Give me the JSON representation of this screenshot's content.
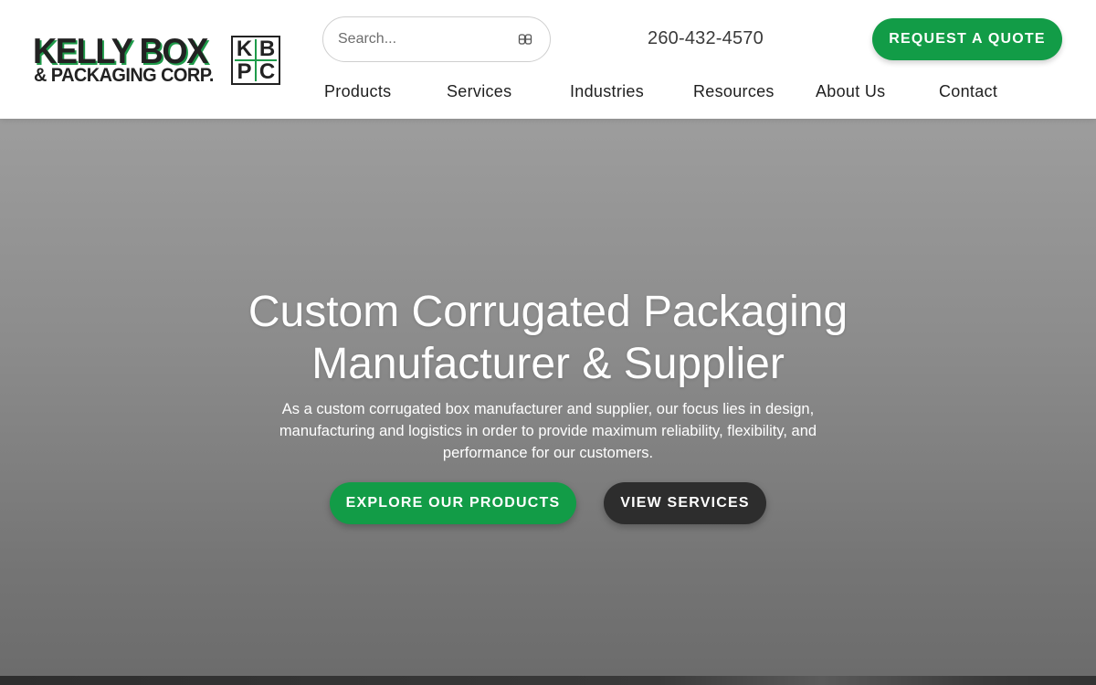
{
  "brand": {
    "name_line1": "KELLY BOX",
    "name_line2": "& PACKAGING CORP.",
    "monogram": [
      "K",
      "B",
      "P",
      "C"
    ],
    "accent_color": "#129c47"
  },
  "search": {
    "placeholder": "Search...",
    "icon": "search-icon"
  },
  "header": {
    "phone": "260-432-4570",
    "quote_label": "REQUEST A QUOTE"
  },
  "nav": {
    "items": [
      {
        "label": "Products"
      },
      {
        "label": "Services"
      },
      {
        "label": "Industries"
      },
      {
        "label": "Resources"
      },
      {
        "label": "About Us"
      },
      {
        "label": "Contact"
      }
    ]
  },
  "hero": {
    "title_line1": "Custom Corrugated Packaging",
    "title_line2": "Manufacturer & Supplier",
    "subtitle": "As a custom corrugated box manufacturer and supplier, our focus lies in design, manufacturing and logistics in order to provide maximum reliability, flexibility, and performance for our customers.",
    "primary_button": "EXPLORE OUR PRODUCTS",
    "secondary_button": "VIEW SERVICES"
  }
}
